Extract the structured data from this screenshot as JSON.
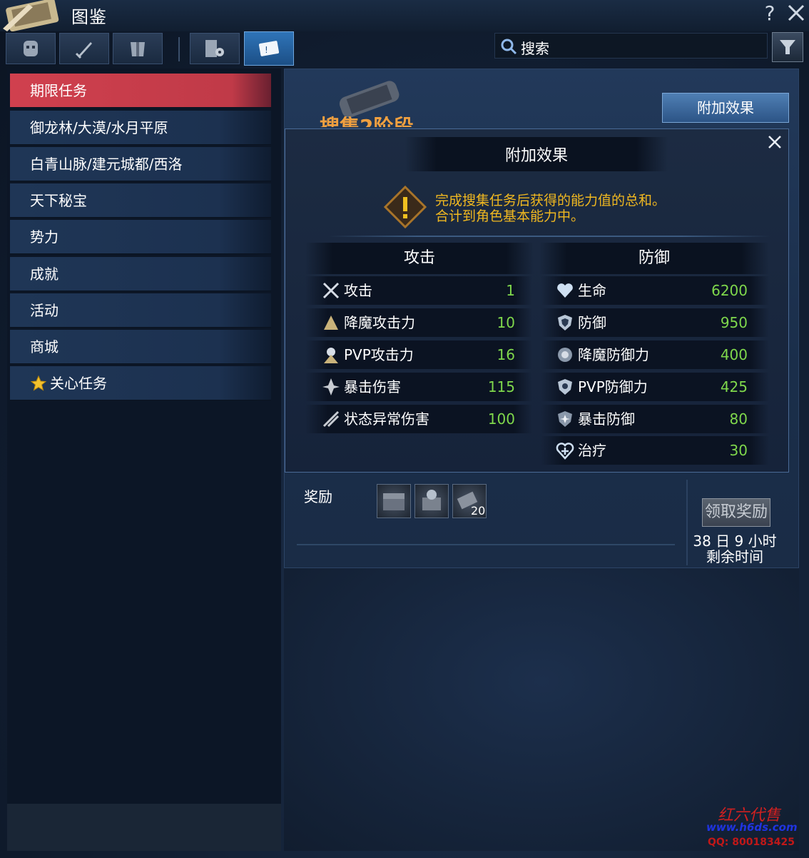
{
  "window": {
    "title": "图鉴",
    "help_label": "?"
  },
  "category_tabs": [
    {
      "icon": "mask-icon"
    },
    {
      "icon": "sword-icon"
    },
    {
      "icon": "armor-icon"
    },
    {
      "icon": "book-gear-icon"
    },
    {
      "icon": "scroll-quest-icon",
      "active": true
    }
  ],
  "search": {
    "placeholder": "搜索"
  },
  "sidebar": {
    "items": [
      {
        "label": "期限任务",
        "active": true
      },
      {
        "label": "御龙林/大漠/水月平原"
      },
      {
        "label": "白青山脉/建元城都/西洛"
      },
      {
        "label": "天下秘宝"
      },
      {
        "label": "势力"
      },
      {
        "label": "成就"
      },
      {
        "label": "活动"
      },
      {
        "label": "商城"
      },
      {
        "label": "关心任务",
        "icon": "star-icon"
      }
    ]
  },
  "main": {
    "stage_title": "搜集2阶段",
    "bonus_button": "附加效果",
    "reward_label": "奖励",
    "reward_count": "20",
    "claim_button": "领取奖励",
    "time_remaining": "38 日 9 小时",
    "time_label": "剩余时间"
  },
  "popup": {
    "title": "附加效果",
    "notice_line1": "完成搜集任务后获得的能力值的总和。",
    "notice_line2": "合计到角色基本能力中。",
    "attack_header": "攻击",
    "defense_header": "防御",
    "attack": [
      {
        "name": "攻击",
        "value": "1",
        "icon": "crossed-swords-icon"
      },
      {
        "name": "降魔攻击力",
        "value": "10",
        "icon": "demon-attack-icon"
      },
      {
        "name": "PVP攻击力",
        "value": "16",
        "icon": "pvp-attack-icon"
      },
      {
        "name": "暴击伤害",
        "value": "115",
        "icon": "critical-damage-icon"
      },
      {
        "name": "状态异常伤害",
        "value": "100",
        "icon": "status-damage-icon"
      }
    ],
    "defense": [
      {
        "name": "生命",
        "value": "6200",
        "icon": "heart-icon"
      },
      {
        "name": "防御",
        "value": "950",
        "icon": "shield-icon"
      },
      {
        "name": "降魔防御力",
        "value": "400",
        "icon": "demon-defense-icon"
      },
      {
        "name": "PVP防御力",
        "value": "425",
        "icon": "pvp-defense-icon"
      },
      {
        "name": "暴击防御",
        "value": "80",
        "icon": "critical-defense-icon"
      },
      {
        "name": "治疗",
        "value": "30",
        "icon": "heal-icon"
      }
    ]
  },
  "watermark": {
    "line1": "红六代售",
    "line2": "www.h6ds.com",
    "line3": "QQ: 800183425"
  },
  "colors": {
    "active_sidebar": "#d0404e",
    "stat_value": "#7fd84c",
    "notice": "#f0b820",
    "active_tab": "#2f74b8"
  }
}
